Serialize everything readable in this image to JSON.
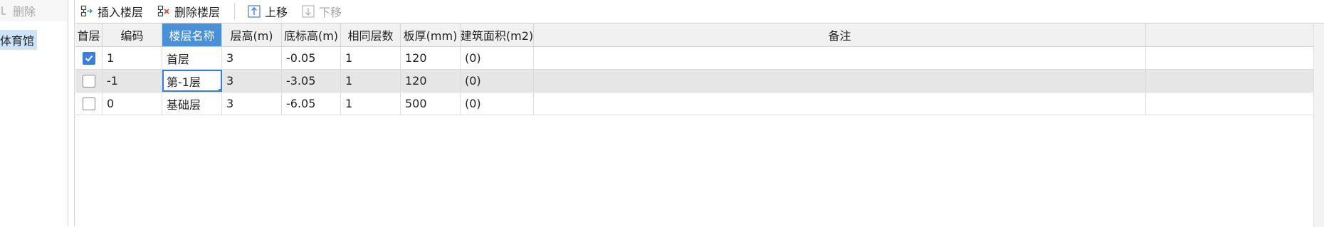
{
  "left": {
    "delete_label": "删除",
    "tree_item": "体育馆"
  },
  "toolbar": {
    "insert_label": "插入楼层",
    "delete_label": "删除楼层",
    "up_label": "上移",
    "down_label": "下移"
  },
  "grid": {
    "headers": [
      "首层",
      "编码",
      "楼层名称",
      "层高(m)",
      "底标高(m)",
      "相同层数",
      "板厚(mm)",
      "建筑面积(m2)",
      "备注"
    ],
    "rows": [
      {
        "is_first": true,
        "code": "1",
        "name": "首层",
        "height": "3",
        "bottom": "-0.05",
        "same_count": "1",
        "thickness": "120",
        "area": "(0)",
        "note": ""
      },
      {
        "is_first": false,
        "code": "-1",
        "name": "第-1层",
        "height": "3",
        "bottom": "-3.05",
        "same_count": "1",
        "thickness": "120",
        "area": "(0)",
        "note": ""
      },
      {
        "is_first": false,
        "code": "0",
        "name": "基础层",
        "height": "3",
        "bottom": "-6.05",
        "same_count": "1",
        "thickness": "500",
        "area": "(0)",
        "note": ""
      }
    ],
    "selected_row": 1,
    "focused_column": "name"
  },
  "colors": {
    "accent": "#3b7dd8",
    "header_active": "#4a90d9",
    "selected_row": "#e6e6e6",
    "tree_selected": "#cde3f7"
  }
}
